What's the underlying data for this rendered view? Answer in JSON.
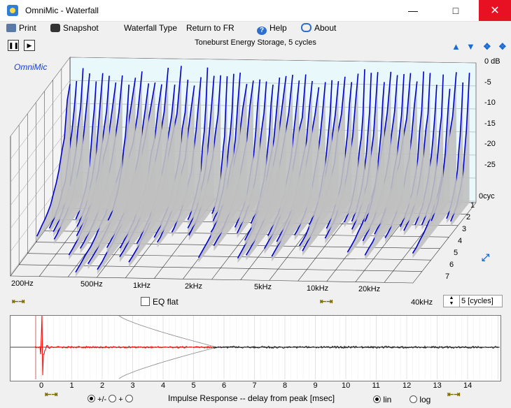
{
  "window": {
    "title": "OmniMic - Waterfall"
  },
  "menu": {
    "print": "Print",
    "snapshot": "Snapshot",
    "waterfall_type": "Waterfall Type",
    "return_fr": "Return to FR",
    "help": "Help",
    "about": "About"
  },
  "plot": {
    "title": "Toneburst Energy Storage, 5 cycles",
    "brand": "OmniMic",
    "db_labels": [
      "0 dB",
      "-5",
      "-10",
      "-15",
      "-20",
      "-25"
    ],
    "cycle_zero": "0cyc",
    "cycle_labels": [
      "1",
      "2",
      "3",
      "4",
      "5",
      "6",
      "7"
    ],
    "freq_labels": [
      "200Hz",
      "500Hz",
      "1kHz",
      "2kHz",
      "5kHz",
      "10kHz",
      "20kHz",
      "40kHz"
    ]
  },
  "controls": {
    "eq_flat": "EQ flat",
    "cycles_value": "5 [cycles]"
  },
  "impulse": {
    "x_ticks": [
      "0",
      "1",
      "2",
      "3",
      "4",
      "5",
      "6",
      "7",
      "8",
      "9",
      "10",
      "11",
      "12",
      "13",
      "14"
    ],
    "polarity_option": "+/-",
    "caption": "Impulse Response  -- delay from peak [msec]",
    "scale_lin": "lin",
    "scale_log": "log"
  },
  "colors": {
    "waterfall_line": "#0000cc",
    "waterfall_fill": "#c0c0c0",
    "impulse_window": "#ff0000",
    "close_button": "#e81123"
  }
}
